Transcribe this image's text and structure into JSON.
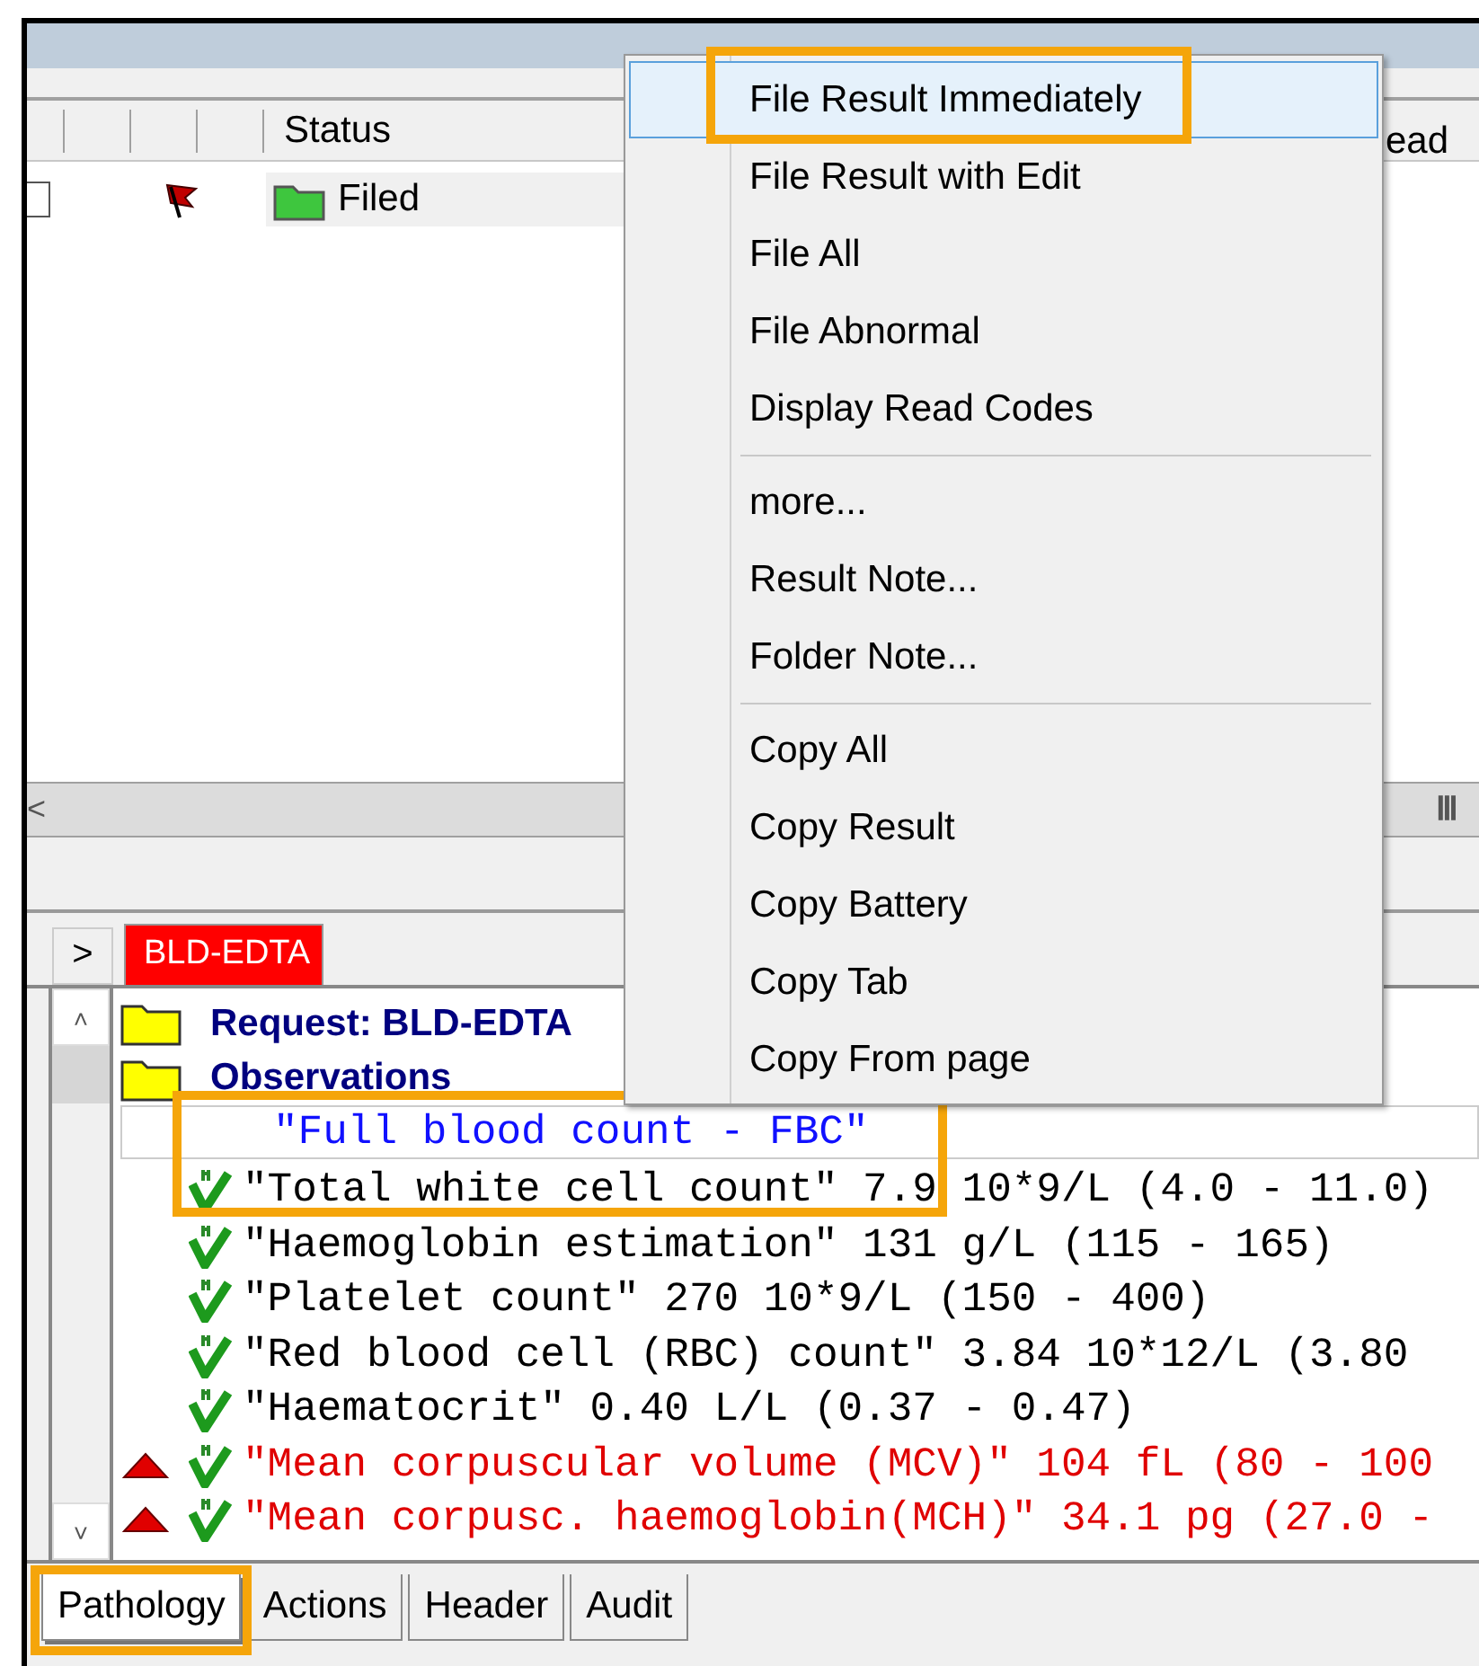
{
  "list": {
    "columns": [
      {
        "label": "Status"
      },
      {
        "label": "ead"
      }
    ],
    "rows": [
      {
        "checked": false,
        "flagged": true,
        "status": "Filed"
      }
    ],
    "scrollbar": {
      "left_arrow": "<",
      "grip": "Ⅲ"
    }
  },
  "battery_nav": ">",
  "tree_scrollbar": {
    "up": "˄",
    "down": "˅"
  },
  "battery_tabs": [
    {
      "label": "BLD-EDTA",
      "selected": true
    }
  ],
  "tree": [
    {
      "kind": "folder",
      "label": "Request: BLD-EDTA"
    },
    {
      "kind": "folder",
      "label": "Observations"
    },
    {
      "kind": "battery",
      "label": "\"Full blood count - FBC\"",
      "highlighted": true
    },
    {
      "kind": "result",
      "abnormal": false,
      "label": "\"Total white cell count\"  7.9 10*9/L (4.0 - 11.0)"
    },
    {
      "kind": "result",
      "abnormal": false,
      "label": "\"Haemoglobin estimation\"  131 g/L (115 - 165)"
    },
    {
      "kind": "result",
      "abnormal": false,
      "label": "\"Platelet count\"  270 10*9/L (150 - 400)"
    },
    {
      "kind": "result",
      "abnormal": false,
      "label": "\"Red blood cell (RBC) count\"  3.84 10*12/L (3.80"
    },
    {
      "kind": "result",
      "abnormal": false,
      "label": "\"Haematocrit\"  0.40 L/L (0.37 - 0.47)"
    },
    {
      "kind": "result",
      "abnormal": true,
      "label": "\"Mean corpuscular volume (MCV)\"  104 fL (80 - 100"
    },
    {
      "kind": "result",
      "abnormal": true,
      "label": "\"Mean corpusc. haemoglobin(MCH)\"  34.1 pg (27.0 -"
    }
  ],
  "bottom_tabs": [
    {
      "label": "Pathology",
      "selected": true,
      "highlighted": true
    },
    {
      "label": "Actions",
      "selected": false,
      "highlighted": false
    },
    {
      "label": "Header",
      "selected": false,
      "highlighted": false
    },
    {
      "label": "Audit",
      "selected": false,
      "highlighted": false
    }
  ],
  "context_menu": {
    "groups": [
      [
        {
          "label": "File Result Immediately",
          "selected": true,
          "highlighted": true
        },
        {
          "label": "File Result with Edit",
          "selected": false,
          "highlighted": false
        },
        {
          "label": "File All",
          "selected": false,
          "highlighted": false
        },
        {
          "label": "File Abnormal",
          "selected": false,
          "highlighted": false
        },
        {
          "label": "Display Read Codes",
          "selected": false,
          "highlighted": false
        }
      ],
      [
        {
          "label": "more...",
          "selected": false,
          "highlighted": false
        },
        {
          "label": "Result Note...",
          "selected": false,
          "highlighted": false
        },
        {
          "label": "Folder Note...",
          "selected": false,
          "highlighted": false
        }
      ],
      [
        {
          "label": "Copy All",
          "selected": false,
          "highlighted": false
        },
        {
          "label": "Copy Result",
          "selected": false,
          "highlighted": false
        },
        {
          "label": "Copy Battery",
          "selected": false,
          "highlighted": false
        },
        {
          "label": "Copy Tab",
          "selected": false,
          "highlighted": false
        },
        {
          "label": "Copy From page",
          "selected": false,
          "highlighted": false
        }
      ]
    ]
  }
}
